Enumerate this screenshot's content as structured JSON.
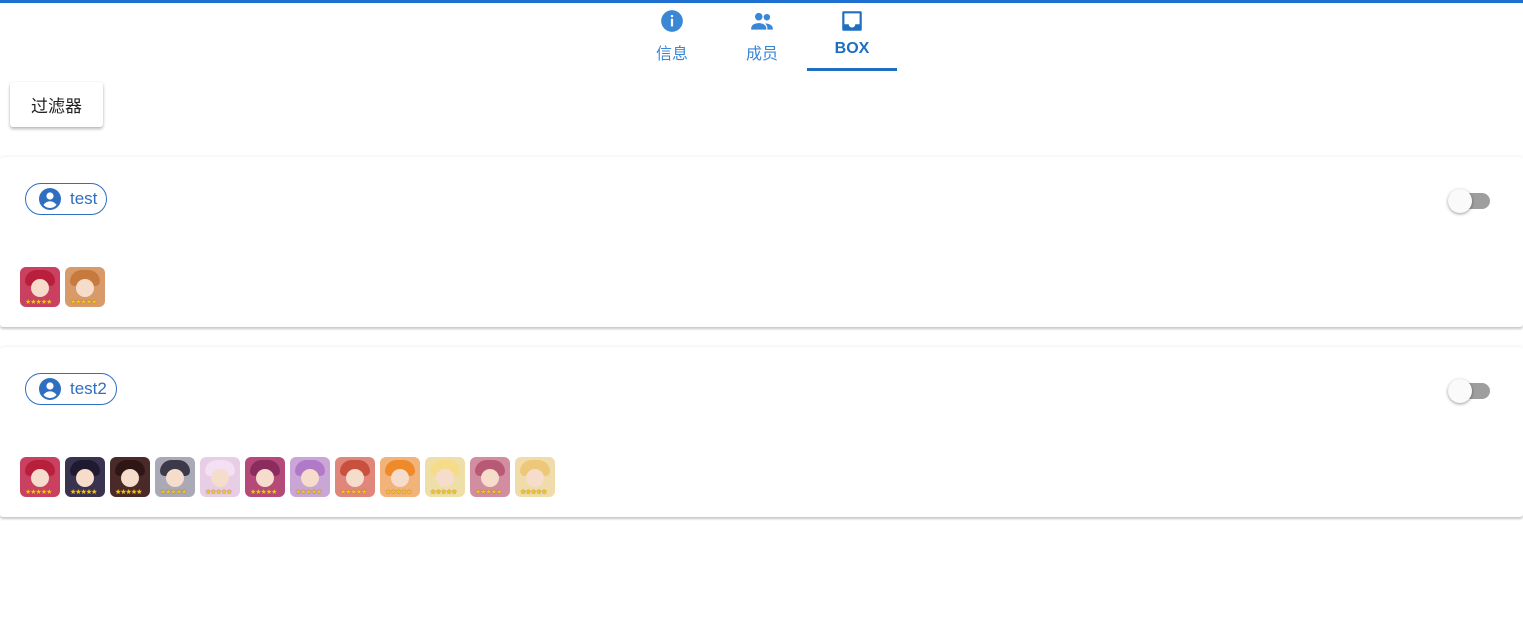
{
  "tabs": [
    {
      "label": "信息",
      "icon": "info-icon",
      "active": false
    },
    {
      "label": "成员",
      "icon": "people-icon",
      "active": false
    },
    {
      "label": "BOX",
      "icon": "inbox-icon",
      "active": true
    }
  ],
  "filter": {
    "label": "过滤器"
  },
  "members": [
    {
      "name": "test",
      "toggle_on": false,
      "characters": [
        {
          "bg": "#c94060",
          "hair": "#b81f3a",
          "stars": "★★★★★"
        },
        {
          "bg": "#d99a6a",
          "hair": "#c67a3e",
          "stars": "★★★★★"
        }
      ]
    },
    {
      "name": "test2",
      "toggle_on": false,
      "characters": [
        {
          "bg": "#c94060",
          "hair": "#b81f3a",
          "stars": "★★★★★"
        },
        {
          "bg": "#3a3350",
          "hair": "#1f1a30",
          "stars": "★★★★★"
        },
        {
          "bg": "#4a2a28",
          "hair": "#2e1614",
          "stars": "★★★★★"
        },
        {
          "bg": "#a9a9b8",
          "hair": "#3c3a48",
          "stars": "★★★★★"
        },
        {
          "bg": "#e7cde6",
          "hair": "#f3e0f2",
          "stars": "★★★★★"
        },
        {
          "bg": "#b54a7a",
          "hair": "#8a2d5e",
          "stars": "★★★★★"
        },
        {
          "bg": "#c9a6d6",
          "hair": "#b07ac8",
          "stars": "★★★★★"
        },
        {
          "bg": "#e0867a",
          "hair": "#c9503f",
          "stars": "★★★★★"
        },
        {
          "bg": "#f2b37a",
          "hair": "#ee8a2a",
          "stars": "★★★★★"
        },
        {
          "bg": "#eedfa8",
          "hair": "#f4dc8a",
          "stars": "★★★★★"
        },
        {
          "bg": "#d28ea0",
          "hair": "#b85a76",
          "stars": "★★★★★"
        },
        {
          "bg": "#f0dcaa",
          "hair": "#ecc878",
          "stars": "★★★★★"
        }
      ]
    }
  ]
}
